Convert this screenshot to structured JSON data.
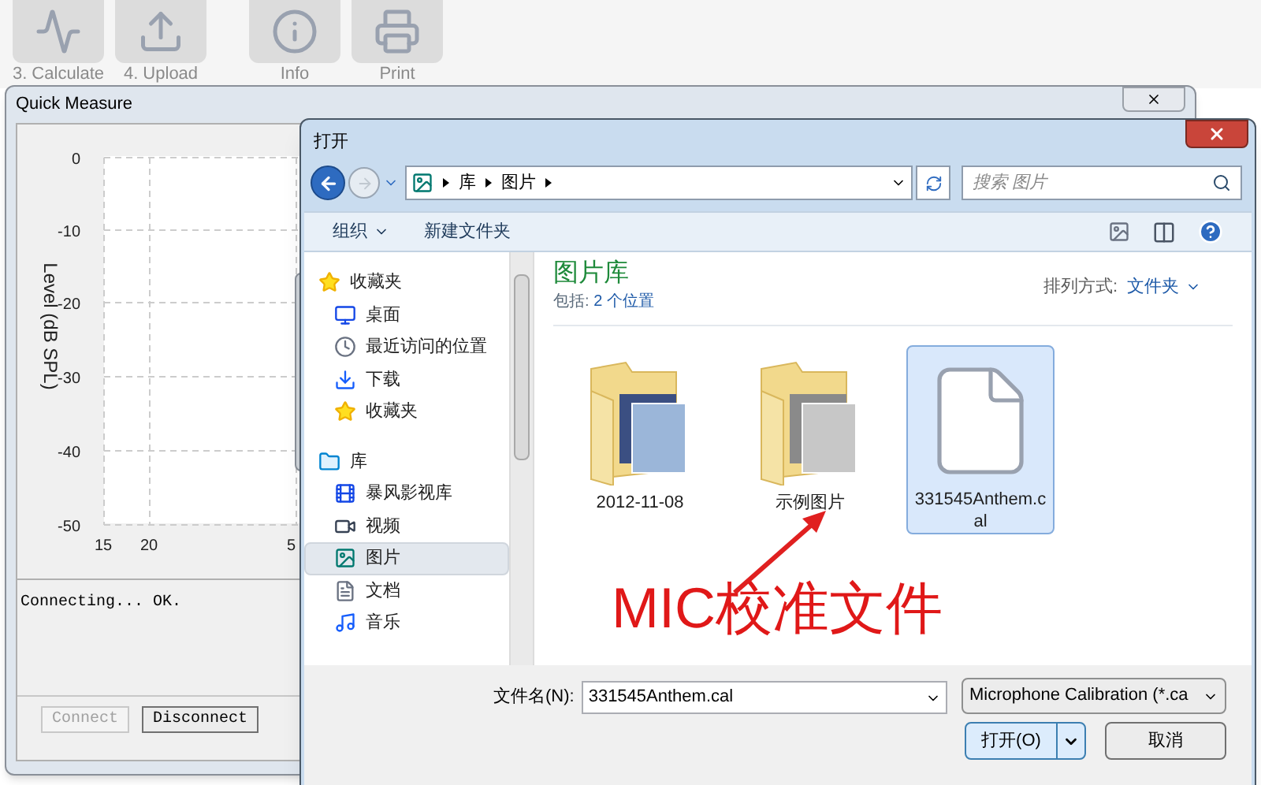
{
  "toolbar": [
    {
      "label": "3. Calculate"
    },
    {
      "label": "4. Upload"
    },
    {
      "label": "Info"
    },
    {
      "label": "Print"
    }
  ],
  "quick_measure": {
    "title": "Quick Measure",
    "chart": {
      "ylabel": "Level (dB SPL)",
      "y_tick_labels": [
        "0",
        "-10",
        "-20",
        "-30",
        "-40",
        "-50"
      ],
      "x_tick_labels": [
        "15",
        "20",
        "5"
      ]
    },
    "log": "Connecting... OK.",
    "buttons": [
      {
        "label": "Connect",
        "disabled": true
      },
      {
        "label": "Disconnect",
        "disabled": false
      }
    ]
  },
  "dialog": {
    "title": "打开",
    "breadcrumb": [
      "库",
      "图片"
    ],
    "search": {
      "placeholder": "搜索 图片"
    },
    "commands": [
      {
        "label": "组织",
        "dropdown": true
      },
      {
        "label": "新建文件夹",
        "dropdown": false
      }
    ],
    "nav": [
      {
        "label": "收藏夹",
        "selected": false,
        "children": [
          {
            "label": "桌面",
            "selected": false
          },
          {
            "label": "最近访问的位置",
            "selected": false
          },
          {
            "label": "下载",
            "selected": false
          },
          {
            "label": "收藏夹",
            "selected": false
          }
        ]
      },
      {
        "label": "库",
        "selected": false,
        "children": [
          {
            "label": "暴风影视库",
            "selected": false
          },
          {
            "label": "视频",
            "selected": false
          },
          {
            "label": "图片",
            "selected": true
          },
          {
            "label": "文档",
            "selected": false
          },
          {
            "label": "音乐",
            "selected": false
          }
        ]
      }
    ],
    "library": {
      "title": "图片库",
      "includes_prefix": "包括: ",
      "includes_link": "2 个位置",
      "arrange_label": "排列方式:",
      "arrange_value": "文件夹"
    },
    "items": [
      {
        "name": "2012-11-08",
        "kind": "folder",
        "selected": false
      },
      {
        "name": "示例图片",
        "kind": "folder",
        "selected": false
      },
      {
        "name": "331545Anthem.cal",
        "kind": "file",
        "selected": true
      }
    ],
    "filename_label": "文件名(N):",
    "filename": "331545Anthem.cal",
    "filter": "Microphone Calibration (*.ca",
    "buttons": [
      {
        "label": "打开(O)",
        "split": true
      },
      {
        "label": "取消",
        "split": false
      }
    ]
  },
  "annotation": {
    "text": "MIC校准文件"
  }
}
